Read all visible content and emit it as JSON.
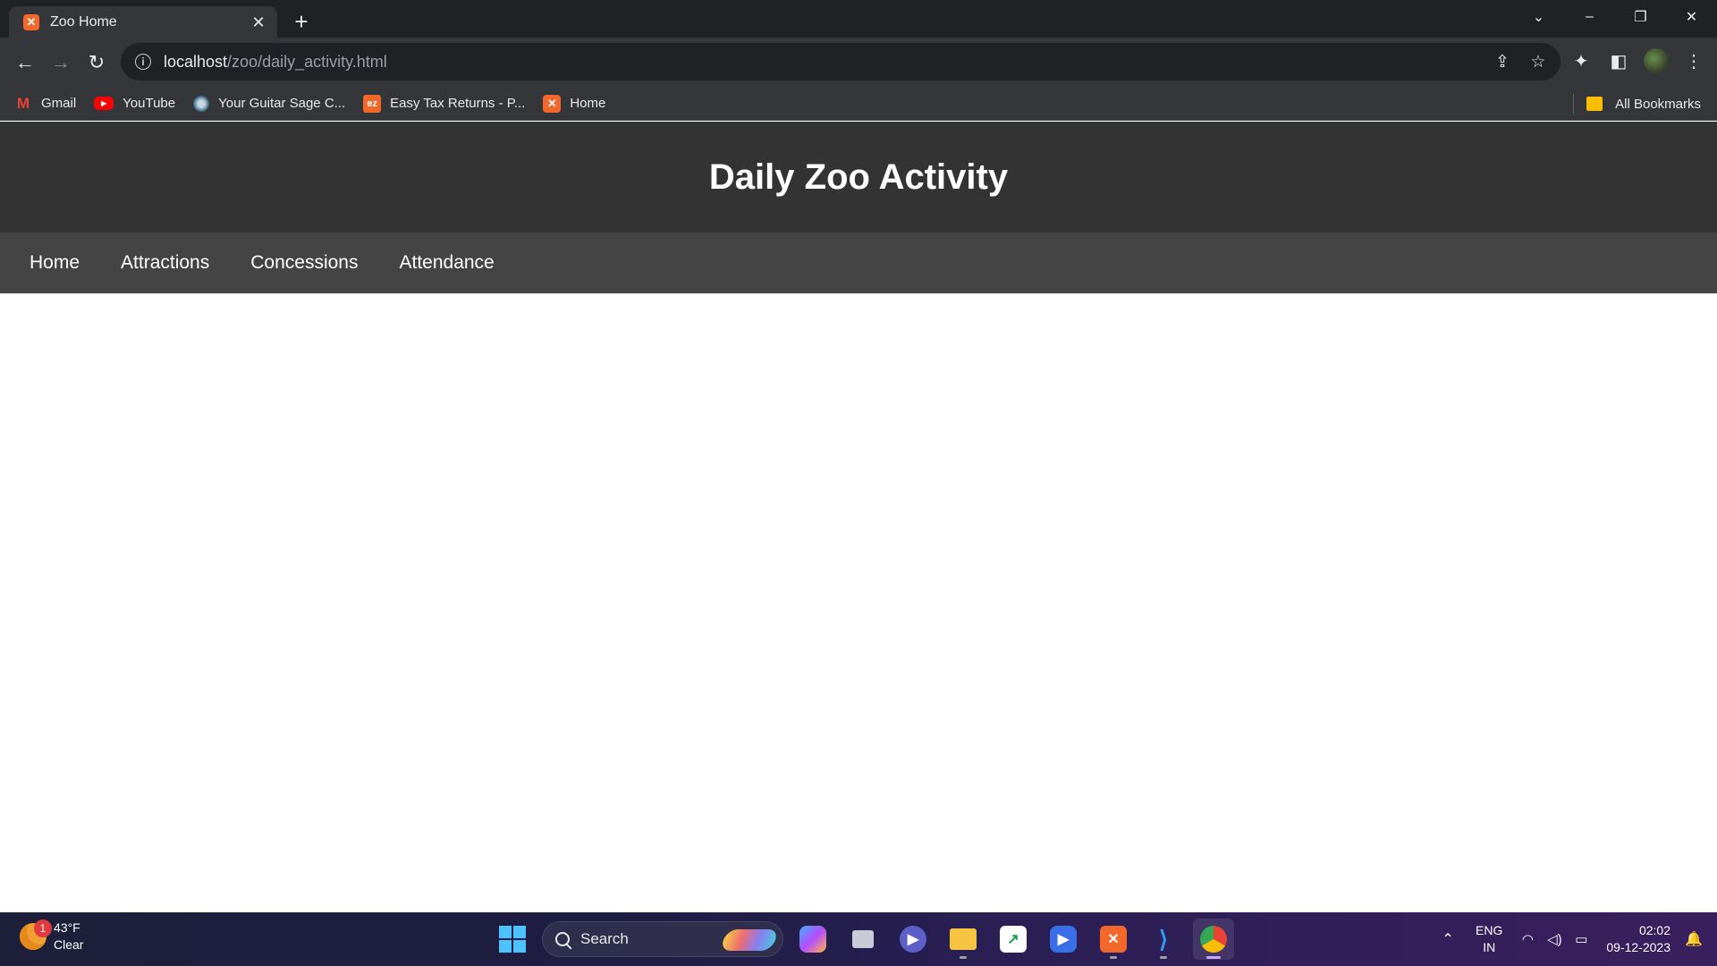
{
  "browser": {
    "tab": {
      "title": "Zoo Home",
      "favicon": "xampp-icon"
    },
    "url": {
      "host": "localhost",
      "path": "/zoo/daily_activity.html"
    },
    "bookmarks": [
      {
        "label": "Gmail",
        "icon": "gmail-icon"
      },
      {
        "label": "YouTube",
        "icon": "youtube-icon"
      },
      {
        "label": "Your Guitar Sage C...",
        "icon": "guitar-sage-icon"
      },
      {
        "label": "Easy Tax Returns - P...",
        "icon": "ez-icon"
      },
      {
        "label": "Home",
        "icon": "xampp-icon"
      }
    ],
    "all_bookmarks_label": "All Bookmarks"
  },
  "page": {
    "header_title": "Daily Zoo Activity",
    "nav": [
      "Home",
      "Attractions",
      "Concessions",
      "Attendance"
    ],
    "colors": {
      "header_bg": "#333333",
      "nav_bg": "#444444",
      "text": "#ffffff"
    }
  },
  "taskbar": {
    "weather": {
      "temp": "43°F",
      "condition": "Clear",
      "badge": "1"
    },
    "search_label": "Search",
    "language": {
      "line1": "ENG",
      "line2": "IN"
    },
    "clock": {
      "time": "02:02",
      "date": "09-12-2023"
    }
  }
}
